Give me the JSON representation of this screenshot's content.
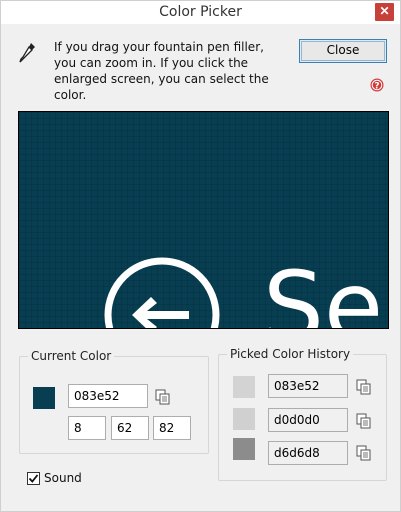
{
  "window": {
    "title": "Color Picker"
  },
  "instruction": "If you drag your fountain pen filler, you can zoom in. If you click the enlarged screen, you can select the color.",
  "buttons": {
    "close": "Close"
  },
  "icons": {
    "title_close": "close-icon",
    "dropper": "eyedropper-icon",
    "help": "help-icon",
    "copy": "copy-icon",
    "checkmark": "checkmark-icon"
  },
  "preview": {
    "background_color": "#083e52",
    "zoomed_text": "Sel"
  },
  "current_color": {
    "label": "Current Color",
    "hex": "083e52",
    "rgb": {
      "r": "8",
      "g": "62",
      "b": "82"
    },
    "swatch_color": "#083e52"
  },
  "history": {
    "label": "Picked Color History",
    "items": [
      {
        "hex": "083e52",
        "swatch_color": "#d3d3d3"
      },
      {
        "hex": "d0d0d0",
        "swatch_color": "#d0d0d0"
      },
      {
        "hex": "d6d6d8",
        "swatch_color": "#8c8c8c"
      }
    ]
  },
  "sound": {
    "label": "Sound",
    "checked": true
  }
}
